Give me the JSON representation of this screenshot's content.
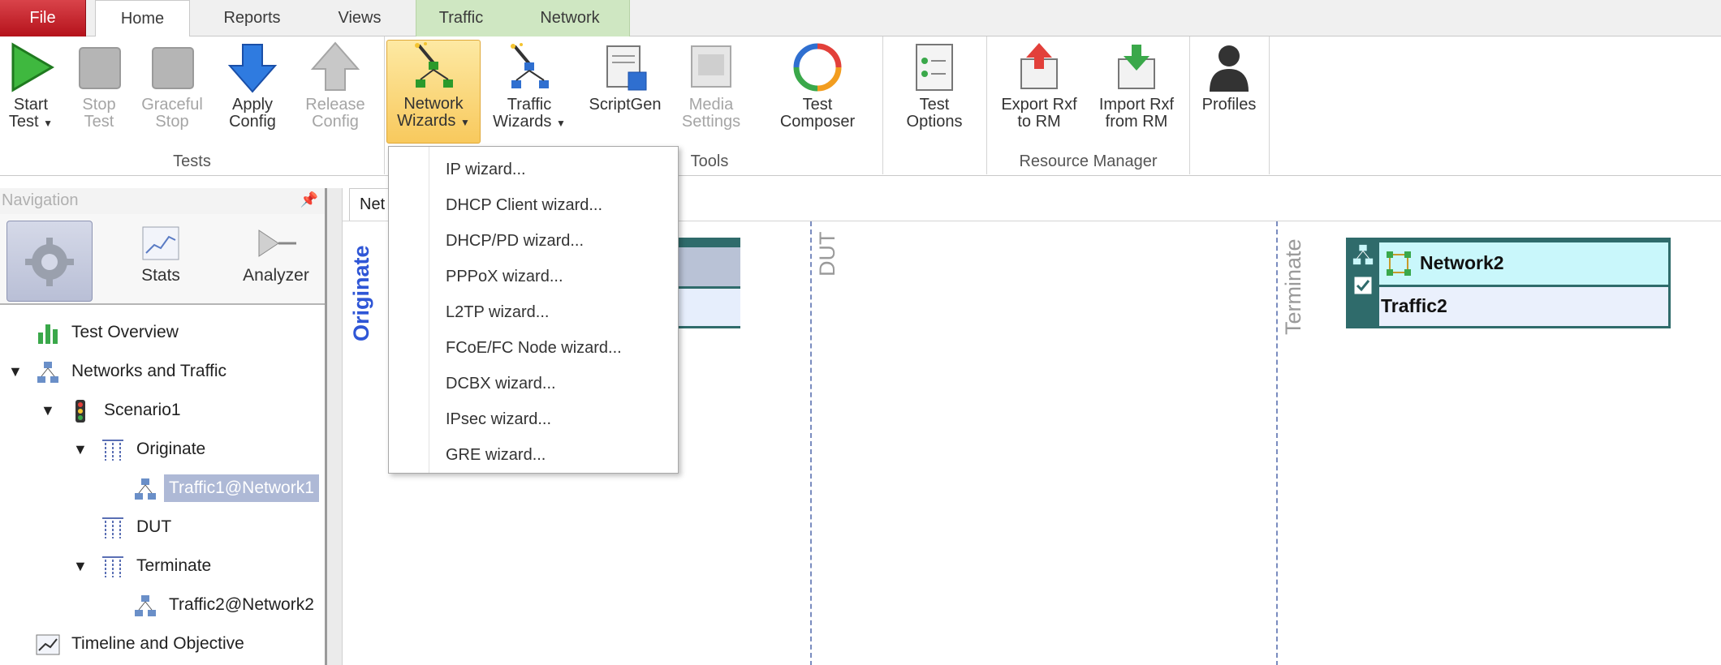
{
  "tabs": {
    "file": "File",
    "home": "Home",
    "reports": "Reports",
    "views": "Views",
    "traffic": "Traffic",
    "network": "Network"
  },
  "ribbon": {
    "tests_group": "Tests",
    "tools_group": "Tools",
    "resource_group": "Resource Manager",
    "start_test": [
      "Start",
      "Test"
    ],
    "stop_test": [
      "Stop",
      "Test"
    ],
    "graceful_stop": [
      "Graceful",
      "Stop"
    ],
    "apply_config": [
      "Apply",
      "Config"
    ],
    "release_config": [
      "Release",
      "Config"
    ],
    "network_wizards": [
      "Network",
      "Wizards"
    ],
    "traffic_wizards": [
      "Traffic",
      "Wizards"
    ],
    "scriptgen": "ScriptGen",
    "media_settings": [
      "Media",
      "Settings"
    ],
    "test_composer": [
      "Test",
      "Composer"
    ],
    "test_options": [
      "Test",
      "Options"
    ],
    "export_rxf": [
      "Export Rxf",
      "to RM"
    ],
    "import_rxf": [
      "Import Rxf",
      "from RM"
    ],
    "profiles": "Profiles"
  },
  "navigation": {
    "header": "Navigation",
    "switch_stats": "Stats",
    "switch_analyzer": "Analyzer",
    "tree": {
      "test_overview": "Test Overview",
      "networks_and_traffic": "Networks and Traffic",
      "scenario": "Scenario1",
      "originate": "Originate",
      "traffic1": "Traffic1@Network1",
      "dut": "DUT",
      "terminate": "Terminate",
      "traffic2": "Traffic2@Network2",
      "timeline": "Timeline and Objective"
    }
  },
  "canvas": {
    "doc_tab": "Net",
    "originate": "Originate",
    "dut": "DUT",
    "terminate": "Terminate",
    "network2_title": "Network2",
    "traffic2_label": "Traffic2"
  },
  "menu": {
    "items": [
      "IP wizard...",
      "DHCP Client wizard...",
      "DHCP/PD wizard...",
      "PPPoX wizard...",
      "L2TP wizard...",
      "FCoE/FC Node wizard...",
      "DCBX wizard...",
      "IPsec wizard...",
      "GRE wizard..."
    ]
  },
  "colors": {
    "accent_blue": "#2f56d6",
    "teal": "#2f6b6b",
    "ctx_green": "#cfe7c2",
    "file_red": "#c51d25"
  }
}
